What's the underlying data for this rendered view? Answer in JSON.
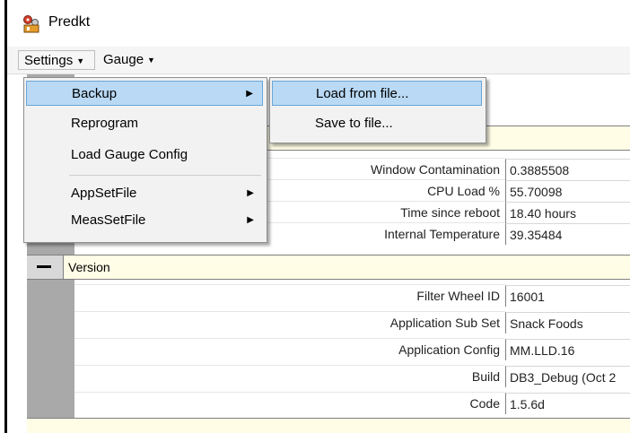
{
  "window": {
    "title": "Predkt",
    "icon": "app-gears-icon"
  },
  "menubar": {
    "settings": "Settings",
    "gauge": "Gauge"
  },
  "settings_menu": {
    "items": [
      {
        "label": "Backup",
        "has_submenu": true
      },
      {
        "label": "Reprogram",
        "has_submenu": false
      },
      {
        "label": "Load Gauge Config",
        "has_submenu": false
      },
      {
        "label": "AppSetFile",
        "has_submenu": true
      },
      {
        "label": "MeasSetFile",
        "has_submenu": true
      }
    ]
  },
  "backup_submenu": {
    "items": [
      {
        "label": "Load from file..."
      },
      {
        "label": "Save to file..."
      }
    ]
  },
  "properties": {
    "status_rows": [
      {
        "label": "Window Contamination",
        "value": "0.3885508"
      },
      {
        "label": "CPU Load %",
        "value": "55.70098"
      },
      {
        "label": "Time since reboot",
        "value": "18.40 hours"
      },
      {
        "label": "Internal Temperature",
        "value": "39.35484"
      }
    ],
    "version_category": "Version",
    "version_rows": [
      {
        "label": "Filter Wheel ID",
        "value": "16001"
      },
      {
        "label": "Application Sub Set",
        "value": "Snack Foods"
      },
      {
        "label": "Application Config",
        "value": "MM.LLD.16"
      },
      {
        "label": "Build",
        "value": "DB3_Debug (Oct 2"
      },
      {
        "label": "Code",
        "value": "1.5.6d"
      }
    ]
  }
}
